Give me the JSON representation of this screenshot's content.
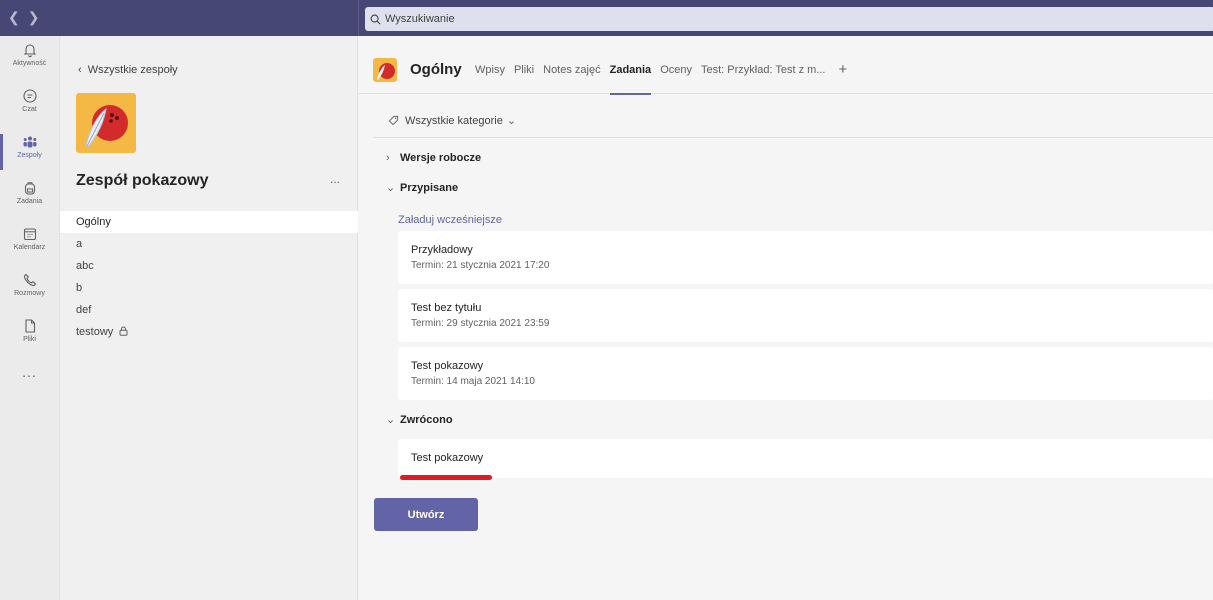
{
  "topbar": {
    "search_placeholder": "Wyszukiwanie",
    "nav_back_icon": "chevron-left-icon",
    "nav_forward_icon": "chevron-right-icon",
    "color": "#464775"
  },
  "rail": {
    "items": [
      {
        "label": "Aktywność",
        "icon": "bell-icon"
      },
      {
        "label": "Czat",
        "icon": "chat-icon"
      },
      {
        "label": "Zespoły",
        "icon": "teams-icon",
        "active": true
      },
      {
        "label": "Zadania",
        "icon": "backpack-icon"
      },
      {
        "label": "Kalendarz",
        "icon": "calendar-icon"
      },
      {
        "label": "Rozmowy",
        "icon": "phone-icon"
      },
      {
        "label": "Pliki",
        "icon": "file-icon"
      }
    ],
    "more": "..."
  },
  "team": {
    "back_label": "Wszystkie zespoły",
    "name": "Zespół pokazowy",
    "more": "...",
    "channels": [
      {
        "label": "Ogólny",
        "active": true
      },
      {
        "label": "a"
      },
      {
        "label": "abc"
      },
      {
        "label": "b"
      },
      {
        "label": "def"
      },
      {
        "label": "testowy",
        "icon": "lock-icon"
      }
    ]
  },
  "main": {
    "channel_title": "Ogólny",
    "tabs": [
      {
        "label": "Wpisy"
      },
      {
        "label": "Pliki"
      },
      {
        "label": "Notes zajęć"
      },
      {
        "label": "Zadania",
        "active": true
      },
      {
        "label": "Oceny"
      },
      {
        "label": "Test: Przykład: Test z m..."
      }
    ],
    "add_tab": "+",
    "filter_label": "Wszystkie kategorie",
    "sections": {
      "drafts": "Wersje robocze",
      "assigned": "Przypisane",
      "returned": "Zwrócono"
    },
    "load_more": "Załaduj wcześniejsze",
    "assigned_items": [
      {
        "title": "Przykładowy",
        "due": "Termin: 21 stycznia 2021 17:20"
      },
      {
        "title": "Test bez tytułu",
        "due": "Termin: 29 stycznia 2021 23:59"
      },
      {
        "title": "Test pokazowy",
        "due": "Termin: 14 maja 2021 14:10"
      }
    ],
    "returned_items": [
      {
        "title": "Test pokazowy"
      }
    ],
    "create_button": "Utwórz",
    "accent": "#6264a7",
    "highlight": "#e21b23"
  }
}
